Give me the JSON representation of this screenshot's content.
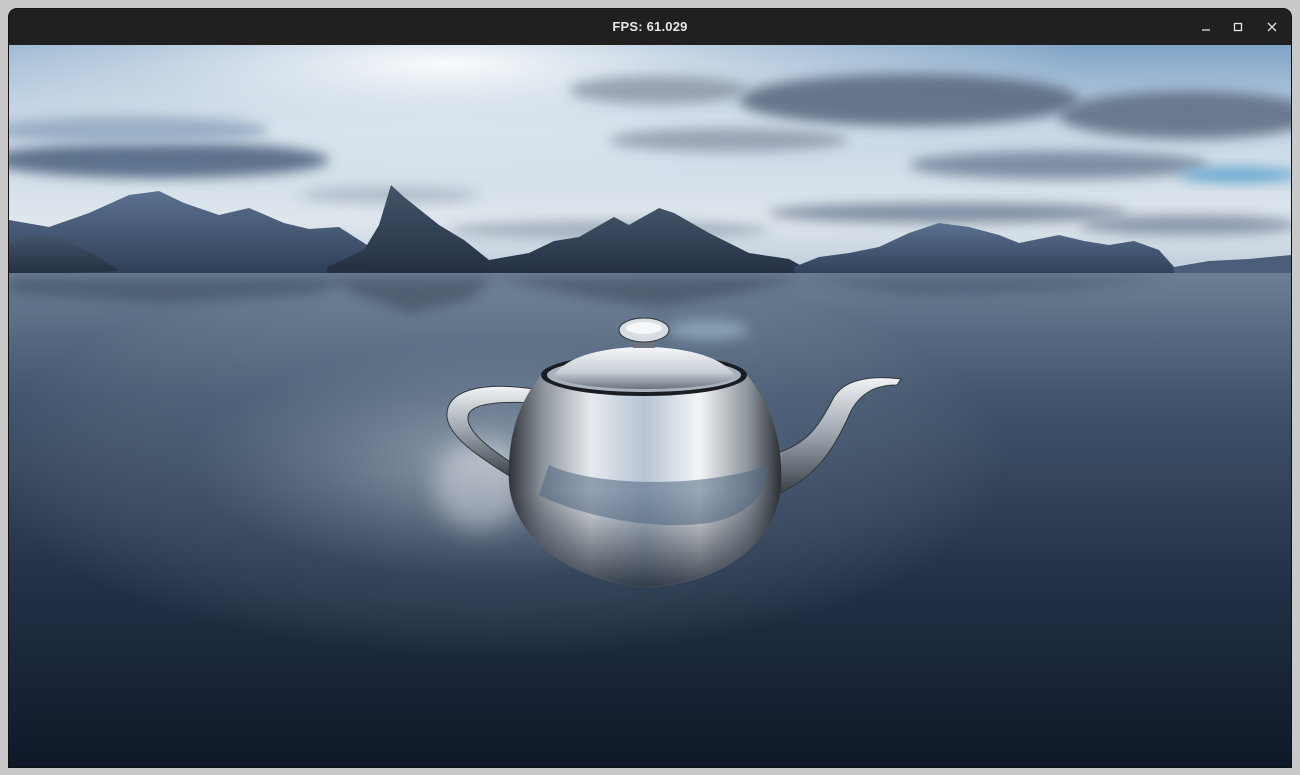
{
  "window": {
    "title": "FPS: 61.029"
  },
  "controls": {
    "minimize_icon": "minimize-icon",
    "maximize_icon": "maximize-icon",
    "close_icon": "close-icon"
  },
  "scene": {
    "object_icon": "teapot",
    "sky_color": "#9ab8d6",
    "water_color": "#1c2a3e",
    "mountain_color": "#3f536f"
  }
}
